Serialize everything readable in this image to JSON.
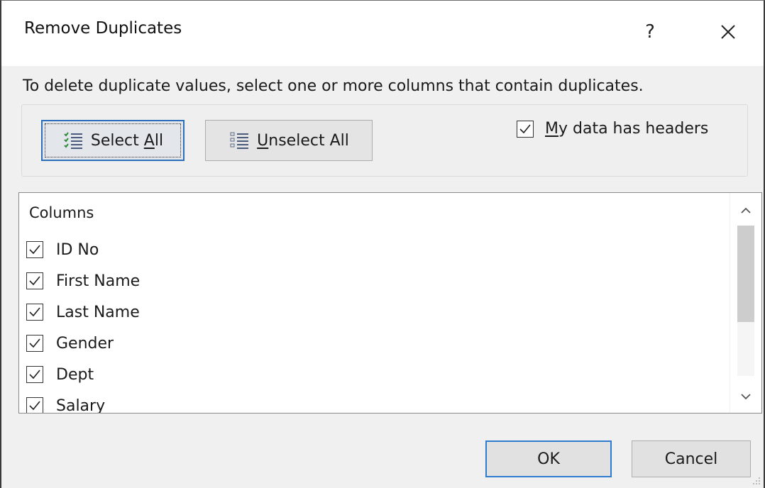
{
  "dialog": {
    "title": "Remove Duplicates",
    "help_label": "?",
    "close_label": "✕",
    "instructions": "To delete duplicate values, select one or more columns that contain duplicates."
  },
  "toolbar": {
    "select_all_pre": "Select ",
    "select_all_key": "A",
    "select_all_post": "ll",
    "unselect_all_key": "U",
    "unselect_all_post": "nselect All"
  },
  "headers_option": {
    "label_key": "M",
    "label_post": "y data has headers",
    "checked": true
  },
  "columns_list": {
    "header": "Columns",
    "items": [
      {
        "label": "ID No",
        "checked": true
      },
      {
        "label": "First Name",
        "checked": true
      },
      {
        "label": "Last Name",
        "checked": true
      },
      {
        "label": "Gender",
        "checked": true
      },
      {
        "label": "Dept",
        "checked": true
      },
      {
        "label": "Salary",
        "checked": true
      }
    ]
  },
  "footer": {
    "ok_label": "OK",
    "cancel_label": "Cancel"
  },
  "colors": {
    "focus_border": "#2b6fb8",
    "dialog_bg": "#f0f0f0",
    "select_icon_green": "#2e8b3a"
  },
  "icons": {
    "select_all": "select-all-icon",
    "unselect_all": "unselect-all-icon",
    "checkmark": "checkmark-icon",
    "scroll_up": "chevron-up-icon",
    "scroll_down": "chevron-down-icon"
  }
}
